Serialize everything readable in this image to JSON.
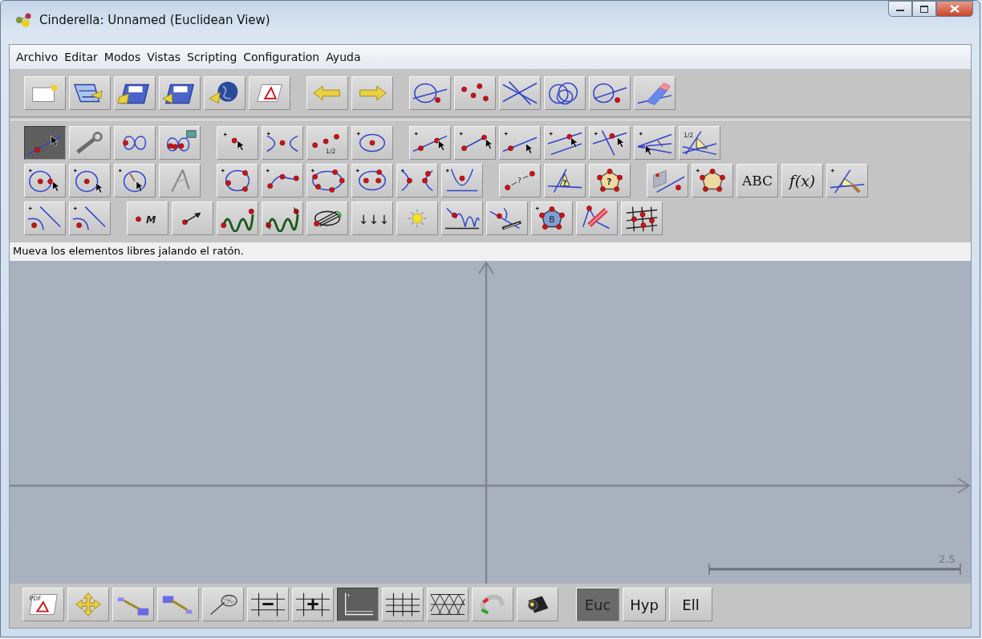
{
  "window": {
    "title": "Cinderella: Unnamed (Euclidean View)"
  },
  "menu": [
    "Archivo",
    "Editar",
    "Modos",
    "Vistas",
    "Scripting",
    "Configuration",
    "Ayuda"
  ],
  "tool_rows": [
    [
      [
        {
          "selected": true
        },
        {
          "selected": false
        },
        {
          "selected": false
        },
        {
          "selected": false
        }
      ],
      [
        {
          "selected": false
        },
        {
          "selected": false
        },
        {
          "selected": false,
          "label": "1/2"
        },
        {
          "selected": false
        }
      ],
      [
        {
          "selected": false
        },
        {
          "selected": false
        },
        {
          "selected": false
        },
        {
          "selected": false
        },
        {
          "selected": false
        },
        {
          "selected": false
        },
        {
          "selected": false,
          "label": "1/2"
        }
      ]
    ],
    [
      [
        {
          "selected": false
        },
        {
          "selected": false
        },
        {
          "selected": false
        },
        {
          "selected": false
        }
      ],
      [
        {
          "selected": false
        },
        {
          "selected": false
        },
        {
          "selected": false
        },
        {
          "selected": false
        },
        {
          "selected": false
        },
        {
          "selected": false
        }
      ],
      [
        {
          "selected": false,
          "label": "?"
        },
        {
          "selected": false,
          "label": "?"
        },
        {
          "selected": false,
          "label": "?"
        }
      ],
      [
        {
          "selected": false
        },
        {
          "selected": false
        },
        {
          "selected": false,
          "label": "ABC"
        },
        {
          "selected": false,
          "label": "f(x)"
        },
        {
          "selected": false
        }
      ]
    ],
    [
      [
        {
          "selected": false
        },
        {
          "selected": false
        }
      ],
      [
        {
          "selected": false,
          "label": "M"
        },
        {
          "selected": false
        },
        {
          "selected": false
        },
        {
          "selected": false
        },
        {
          "selected": false
        },
        {
          "selected": false,
          "label": "↓↓↓"
        },
        {
          "selected": false
        },
        {
          "selected": false
        },
        {
          "selected": false
        },
        {
          "selected": false,
          "label": "B"
        },
        {
          "selected": false
        },
        {
          "selected": false
        }
      ]
    ]
  ],
  "status": "Mueva los elementos libres jalando el ratón.",
  "canvas": {
    "scale_label": "2.5"
  },
  "view_toolbar": [
    {
      "selected": false,
      "label": "PDF"
    },
    {
      "selected": false
    },
    {
      "selected": false
    },
    {
      "selected": false
    },
    {
      "selected": false
    },
    {
      "selected": false
    },
    {
      "selected": false
    },
    {
      "selected": true
    },
    {
      "selected": false
    },
    {
      "selected": false
    },
    {
      "selected": false
    },
    {
      "selected": false
    }
  ],
  "geometry_buttons": [
    {
      "label": "Euc",
      "selected": true
    },
    {
      "label": "Hyp",
      "selected": false
    },
    {
      "label": "Ell",
      "selected": false
    }
  ]
}
